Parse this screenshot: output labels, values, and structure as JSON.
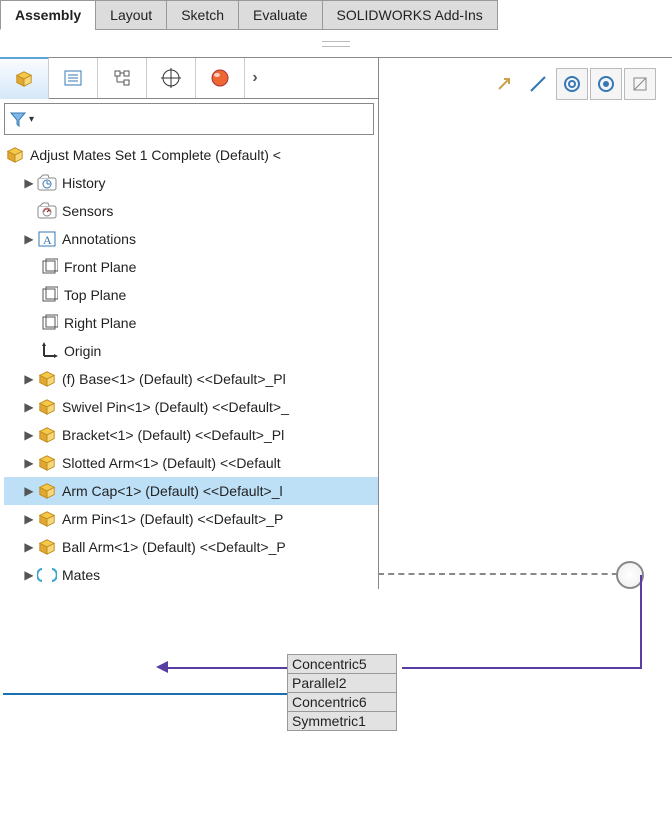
{
  "tabs": {
    "items": [
      "Assembly",
      "Layout",
      "Sketch",
      "Evaluate",
      "SOLIDWORKS Add-Ins"
    ],
    "active_index": 0
  },
  "tree": {
    "root": "Adjust Mates Set 1 Complete (Default) <",
    "nodes": [
      {
        "label": "History",
        "icon": "history",
        "expander": true
      },
      {
        "label": "Sensors",
        "icon": "sensors",
        "expander": false
      },
      {
        "label": "Annotations",
        "icon": "annotations",
        "expander": true
      },
      {
        "label": "Front Plane",
        "icon": "plane",
        "expander": false
      },
      {
        "label": "Top Plane",
        "icon": "plane",
        "expander": false
      },
      {
        "label": "Right Plane",
        "icon": "plane",
        "expander": false
      },
      {
        "label": "Origin",
        "icon": "origin",
        "expander": false
      },
      {
        "label": "(f) Base<1> (Default) <<Default>_Pl",
        "icon": "part",
        "expander": true
      },
      {
        "label": "Swivel Pin<1> (Default) <<Default>_",
        "icon": "part",
        "expander": true
      },
      {
        "label": "Bracket<1> (Default) <<Default>_Pl",
        "icon": "part",
        "expander": true
      },
      {
        "label": "Slotted Arm<1> (Default) <<Default",
        "icon": "part",
        "expander": true
      },
      {
        "label": "Arm Cap<1> (Default) <<Default>_l",
        "icon": "part",
        "expander": true,
        "selected": true
      },
      {
        "label": "Arm Pin<1> (Default) <<Default>_P",
        "icon": "part",
        "expander": true
      },
      {
        "label": "Ball Arm<1> (Default) <<Default>_P",
        "icon": "part",
        "expander": true
      },
      {
        "label": "Mates",
        "icon": "mates",
        "expander": true
      }
    ]
  },
  "mate_tooltip": [
    "Concentric5",
    "Parallel2",
    "Concentric6",
    "Symmetric1"
  ]
}
